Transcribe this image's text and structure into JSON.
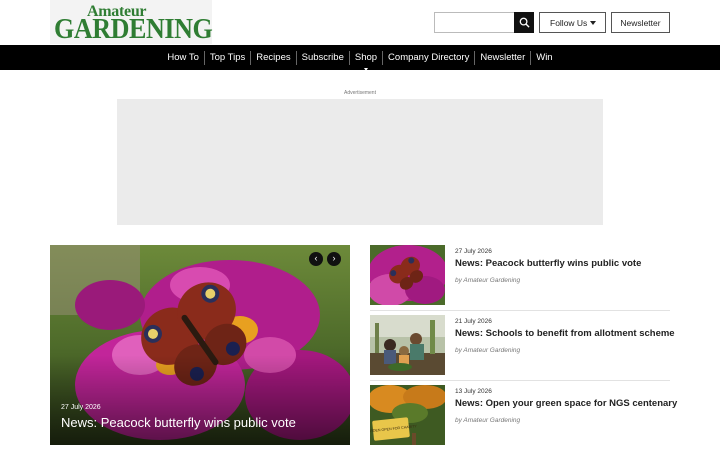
{
  "brand": {
    "logo_line1": "Amateur",
    "logo_line2": "GARDENING"
  },
  "header": {
    "search_placeholder": "",
    "follow_label": "Follow Us",
    "newsletter_label": "Newsletter"
  },
  "nav": {
    "items": [
      "How To",
      "Top Tips",
      "Recipes",
      "Subscribe",
      "Shop",
      "Company Directory",
      "Newsletter",
      "Win"
    ]
  },
  "ad": {
    "label": "Advertisement"
  },
  "hero": {
    "date": "27 July 2026",
    "title": "News: Peacock butterfly wins public vote",
    "prev_icon": "‹",
    "next_icon": "›"
  },
  "side_articles": [
    {
      "date": "27 July 2026",
      "title": "News: Peacock butterfly wins public vote",
      "byline": "by Amateur Gardening"
    },
    {
      "date": "21 July 2026",
      "title": "News: Schools to benefit from allotment scheme",
      "byline": "by Amateur Gardening"
    },
    {
      "date": "13 July 2026",
      "title": "News: Open your green space for NGS centenary",
      "byline": "by Amateur Gardening",
      "image_sign_text": "GARDEN OPEN FOR CHARITY"
    }
  ],
  "colors": {
    "brand_green": "#2f7d33",
    "nav_bg": "#000000",
    "ad_bg": "#ebebeb"
  }
}
